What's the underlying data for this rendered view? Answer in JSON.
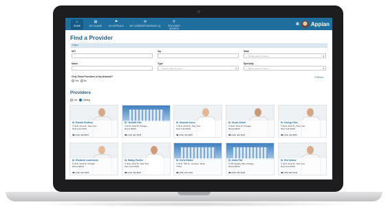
{
  "nav": {
    "items": [
      {
        "icon": "home-icon",
        "glyph": "⌂",
        "label": "HOME"
      },
      {
        "icon": "claims-icon",
        "glyph": "▤",
        "label": "MY CLAIMS"
      },
      {
        "icon": "appeals-icon",
        "glyph": "⚑",
        "label": "MY APPEALS"
      },
      {
        "icon": "correspondence-icon",
        "glyph": "✉",
        "label": "MY CORRESPONDENCE (1)"
      },
      {
        "icon": "location-pin-icon",
        "glyph": "⚲",
        "label": "PROVIDER SEARCH"
      }
    ],
    "brand": "Appian"
  },
  "page": {
    "title": "Find a Provider",
    "filters_label": "Filters",
    "providers_title": "Providers"
  },
  "filters": {
    "npi_label": "NPI",
    "zip_label": "Zip",
    "state_label": "State",
    "state_placeholder": "--- Please select a value ---",
    "name_label": "Name",
    "type_label": "Type",
    "type_placeholder": "--- Please select a value ---",
    "specialty_label": "Specialty",
    "specialty_placeholder": "--- Please select a value ---",
    "network_label": "Only Show Providers in My Network?",
    "network_yes": "Yes",
    "network_no": "No",
    "reset": "Reset"
  },
  "view": {
    "list": "List",
    "catalog": "Catalog"
  },
  "colors": {
    "nav_bg": "#1f6e9e",
    "accent": "#1f5f8b"
  },
  "providers": [
    {
      "name": "Dr. Ronald Geoffrey",
      "address": "44 E. 22nd St., New York, New York 10001",
      "phone": "(223) 462-8657"
    },
    {
      "name": "Dr. Jennifer Kim",
      "address": "22 E. 22nd St. Chicago, Illinois 60613",
      "phone": "(224) 462-2525"
    },
    {
      "name": "Dr. Amanda Jones",
      "address": "44 E. 22nd St., New York, New York 10001",
      "phone": "(223) 462-8657"
    },
    {
      "name": "Dr. Susan Alford",
      "address": "22 E. 22nd St. Chicago, Illinois 60613",
      "phone": "(224) 462-2525"
    },
    {
      "name": "Dr. George Cline",
      "address": "44 E. 22nd St., New York, New York 10001",
      "phone": "(223) 462-8657"
    },
    {
      "name": "Dr. Elizabeth Lowenstein",
      "address": "22 E. 22nd St. Chicago, Illinois 60613",
      "phone": "(224) 462-2525"
    },
    {
      "name": "Dr. Bobby Pontini",
      "address": "44 E. 22nd St., New York, New York 10001",
      "phone": "(223) 462-8657"
    },
    {
      "name": "Dr. Chris Kalane",
      "address": "22 E. 75th St., Houston, Texas 77001",
      "phone": "(555) 220-0346"
    },
    {
      "name": "Dr. Adam Falt",
      "address": "475 Healthy Way, Chicago, Illinois 60613",
      "phone": "(800) 356-3356"
    },
    {
      "name": "Dr. Eric Kalane",
      "address": "44 E. 22nd St., New York, New York 10001",
      "phone": "(555) 820-0346"
    }
  ]
}
